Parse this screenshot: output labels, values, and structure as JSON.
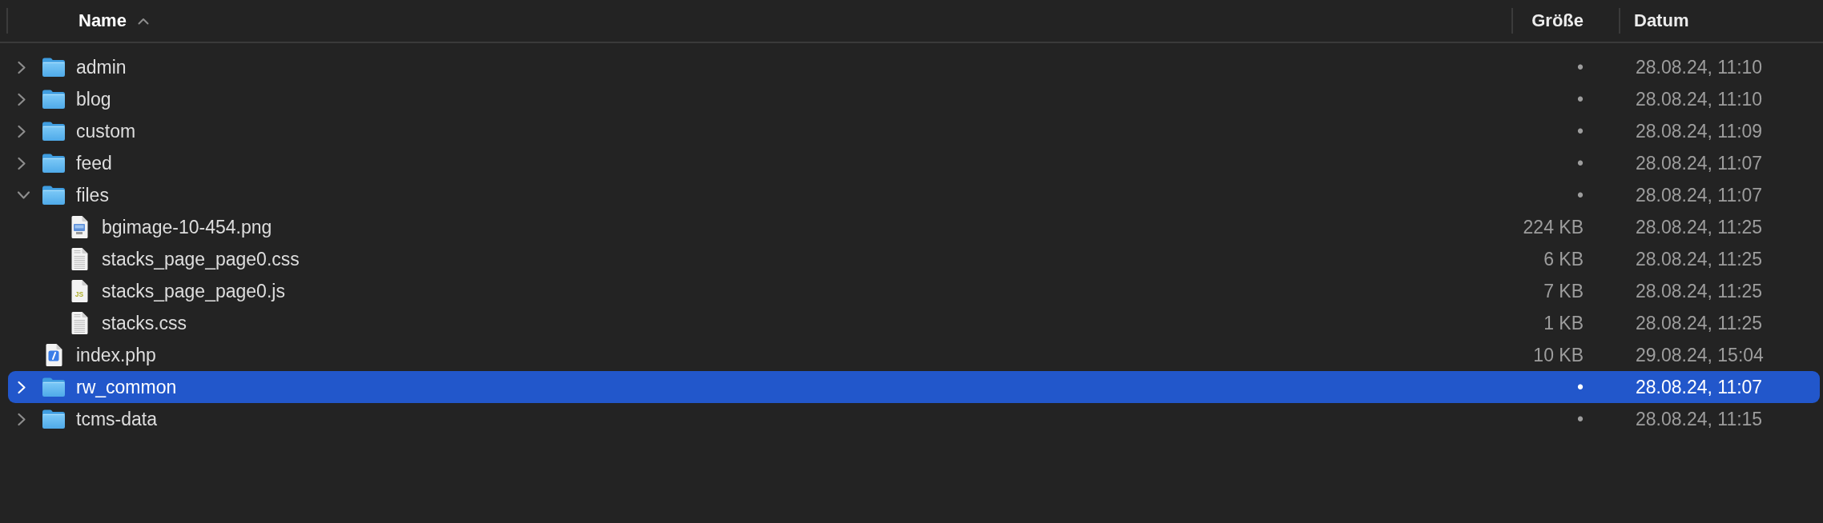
{
  "tree": {
    "columns": [
      {
        "label": "Name",
        "sorted": true,
        "ascending": true
      },
      {
        "label": "Größe",
        "sorted": false
      },
      {
        "label": "Datum",
        "sorted": false
      }
    ],
    "items": [
      {
        "name": "admin",
        "kind": "folder",
        "expanded": false,
        "selected": false,
        "size": "•",
        "date": "28.08.24, 11:10"
      },
      {
        "name": "blog",
        "kind": "folder",
        "expanded": false,
        "selected": false,
        "size": "•",
        "date": "28.08.24, 11:10"
      },
      {
        "name": "custom",
        "kind": "folder",
        "expanded": false,
        "selected": false,
        "size": "•",
        "date": "28.08.24, 11:09"
      },
      {
        "name": "feed",
        "kind": "folder",
        "expanded": false,
        "selected": false,
        "size": "•",
        "date": "28.08.24, 11:07"
      },
      {
        "name": "files",
        "kind": "folder",
        "expanded": true,
        "selected": false,
        "size": "•",
        "date": "28.08.24, 11:07",
        "children": [
          {
            "name": "bgimage-10-454.png",
            "kind": "image",
            "selected": false,
            "size": "224 KB",
            "date": "28.08.24, 11:25"
          },
          {
            "name": "stacks_page_page0.css",
            "kind": "text",
            "selected": false,
            "size": "6 KB",
            "date": "28.08.24, 11:25"
          },
          {
            "name": "stacks_page_page0.js",
            "kind": "javascript",
            "icon_text": "JS",
            "selected": false,
            "size": "7 KB",
            "date": "28.08.24, 11:25"
          },
          {
            "name": "stacks.css",
            "kind": "text",
            "selected": false,
            "size": "1 KB",
            "date": "28.08.24, 11:25"
          }
        ]
      },
      {
        "name": "index.php",
        "kind": "php",
        "selected": false,
        "size": "10 KB",
        "date": "29.08.24, 15:04"
      },
      {
        "name": "rw_common",
        "kind": "folder",
        "expanded": false,
        "selected": true,
        "size": "•",
        "date": "28.08.24, 11:07"
      },
      {
        "name": "tcms-data",
        "kind": "folder",
        "expanded": false,
        "selected": false,
        "size": "•",
        "date": "28.08.24, 11:15"
      }
    ]
  }
}
